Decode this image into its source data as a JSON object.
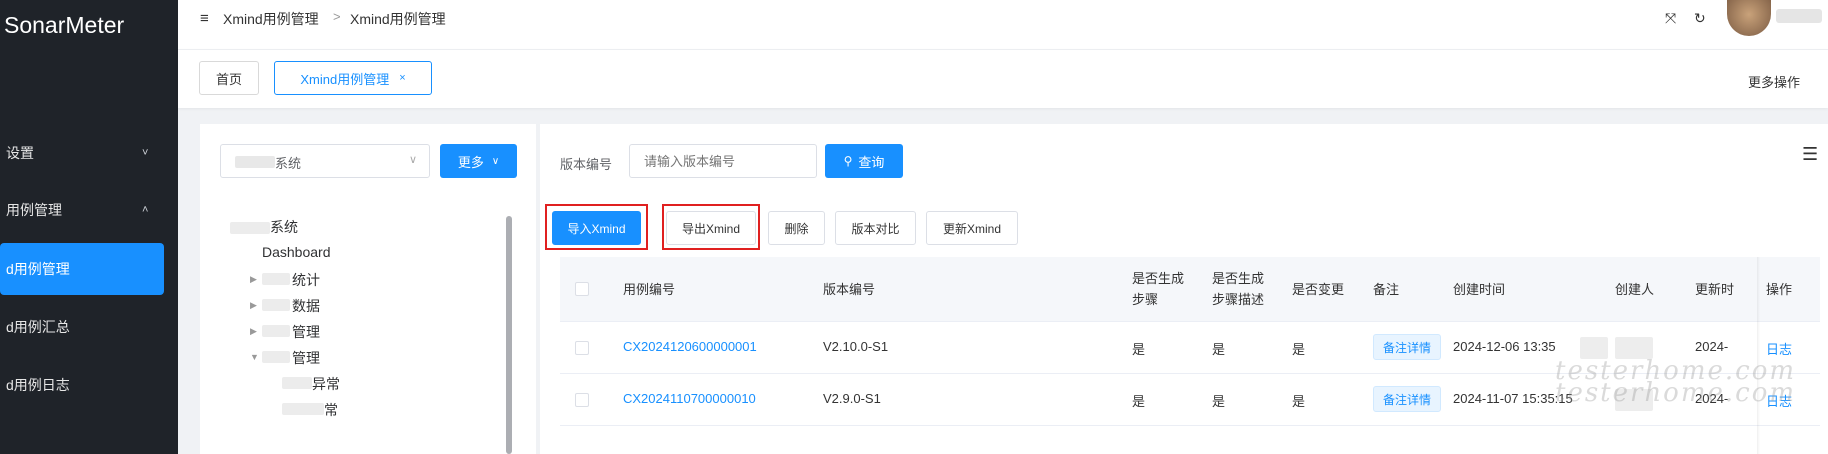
{
  "sidebar": {
    "brand": "SonarMeter",
    "items": [
      {
        "label": "设置",
        "chevron": "˅",
        "active": false
      },
      {
        "label": "用例管理",
        "chevron": "˄",
        "active": false
      },
      {
        "label": "d用例管理",
        "chevron": "",
        "active": true
      },
      {
        "label": "d用例汇总",
        "chevron": "",
        "active": false
      },
      {
        "label": "d用例日志",
        "chevron": "",
        "active": false
      }
    ]
  },
  "header": {
    "breadcrumb": [
      "Xmind用例管理",
      "Xmind用例管理"
    ],
    "breadcrumb_sep": ">",
    "icons": [
      "fullscreen-icon",
      "refresh-icon",
      "avatar"
    ]
  },
  "tabs": {
    "items": [
      {
        "label": "首页",
        "active": false
      },
      {
        "label": "Xmind用例管理",
        "active": true,
        "close": "×"
      }
    ],
    "more_ops": "更多操作"
  },
  "tree": {
    "system_select": {
      "value": "系统"
    },
    "more_button": "更多",
    "nodes": [
      "系统",
      "Dashboard",
      "统计",
      "数据",
      "管理",
      "管理",
      "异常",
      "常"
    ]
  },
  "search": {
    "label": "版本编号",
    "placeholder": "请输入版本编号",
    "query_button": "查询"
  },
  "actions": {
    "import": "导入Xmind",
    "export": "导出Xmind",
    "delete": "删除",
    "compare": "版本对比",
    "update": "更新Xmind"
  },
  "table": {
    "headers": {
      "case_id": "用例编号",
      "version": "版本编号",
      "gen_steps_1": "是否生成",
      "gen_steps_2": "步骤",
      "gen_desc_1": "是否生成",
      "gen_desc_2": "步骤描述",
      "changed": "是否变更",
      "note": "备注",
      "created_at": "创建时间",
      "creator": "创建人",
      "updated_at": "更新时",
      "ops": "操作"
    },
    "rows": [
      {
        "case_id": "CX2024120600000001",
        "version": "V2.10.0-S1",
        "gen_steps": "是",
        "gen_desc": "是",
        "changed": "是",
        "note": "备注详情",
        "created_at": "2024-12-06 13:35",
        "updated_at": "2024-",
        "op": "日志"
      },
      {
        "case_id": "CX2024110700000010",
        "version": "V2.9.0-S1",
        "gen_steps": "是",
        "gen_desc": "是",
        "changed": "是",
        "note": "备注详情",
        "created_at": "2024-11-07 15:35:15",
        "updated_at": "2024-",
        "op": "日志"
      }
    ]
  },
  "watermark": {
    "line1": "testerhome.com",
    "line2": "testerhome.com"
  },
  "colors": {
    "primary": "#1890ff",
    "sidebar_bg": "#1f2329",
    "highlight_box": "#e02020"
  }
}
